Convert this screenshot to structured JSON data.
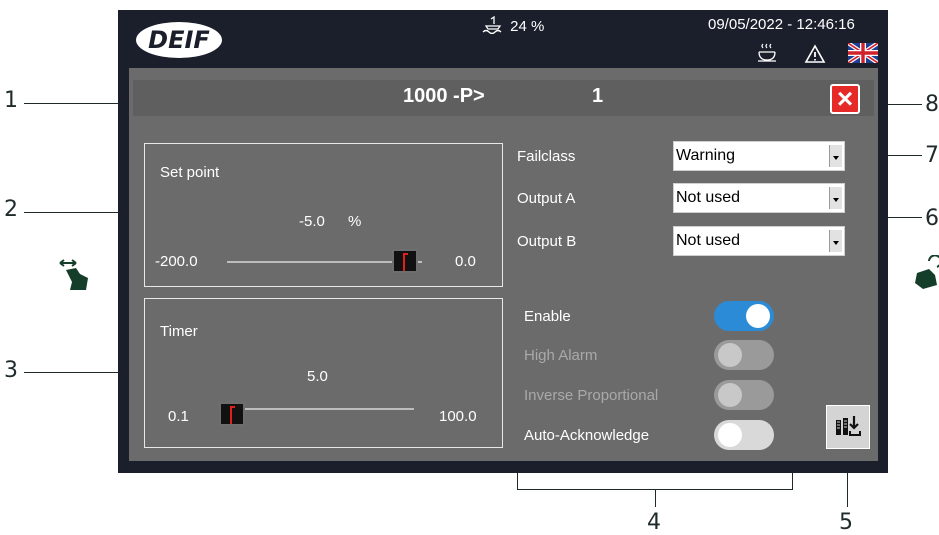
{
  "header": {
    "brand": "DEIF",
    "fuel_value": "24 %",
    "datetime": "09/05/2022 - 12:46:16"
  },
  "dialog": {
    "title_left": "1000 -P>",
    "title_right": "1"
  },
  "setpoint": {
    "label": "Set point",
    "value": "-5.0",
    "unit": "%",
    "min": "-200.0",
    "max": "0.0",
    "level_fraction": 0.975
  },
  "timer": {
    "label": "Timer",
    "value": "5.0",
    "min": "0.1",
    "max": "100.0",
    "level_fraction": 0.05
  },
  "failclass": {
    "label": "Failclass",
    "value": "Warning"
  },
  "output_a": {
    "label": "Output A",
    "value": "Not used"
  },
  "output_b": {
    "label": "Output B",
    "value": "Not used"
  },
  "switches": [
    {
      "label": "Enable",
      "state": "on"
    },
    {
      "label": "High Alarm",
      "state": "disabled"
    },
    {
      "label": "Inverse Proportional",
      "state": "disabled"
    },
    {
      "label": "Auto-Acknowledge",
      "state": "off"
    }
  ],
  "callouts": [
    "1",
    "2",
    "3",
    "4",
    "5",
    "6",
    "7",
    "8"
  ],
  "icons": [
    "fuel-icon",
    "heater-icon",
    "warning-icon",
    "uk-flag-icon",
    "close-icon",
    "download-icon",
    "swipe-hand-icon",
    "tap-hand-icon"
  ]
}
